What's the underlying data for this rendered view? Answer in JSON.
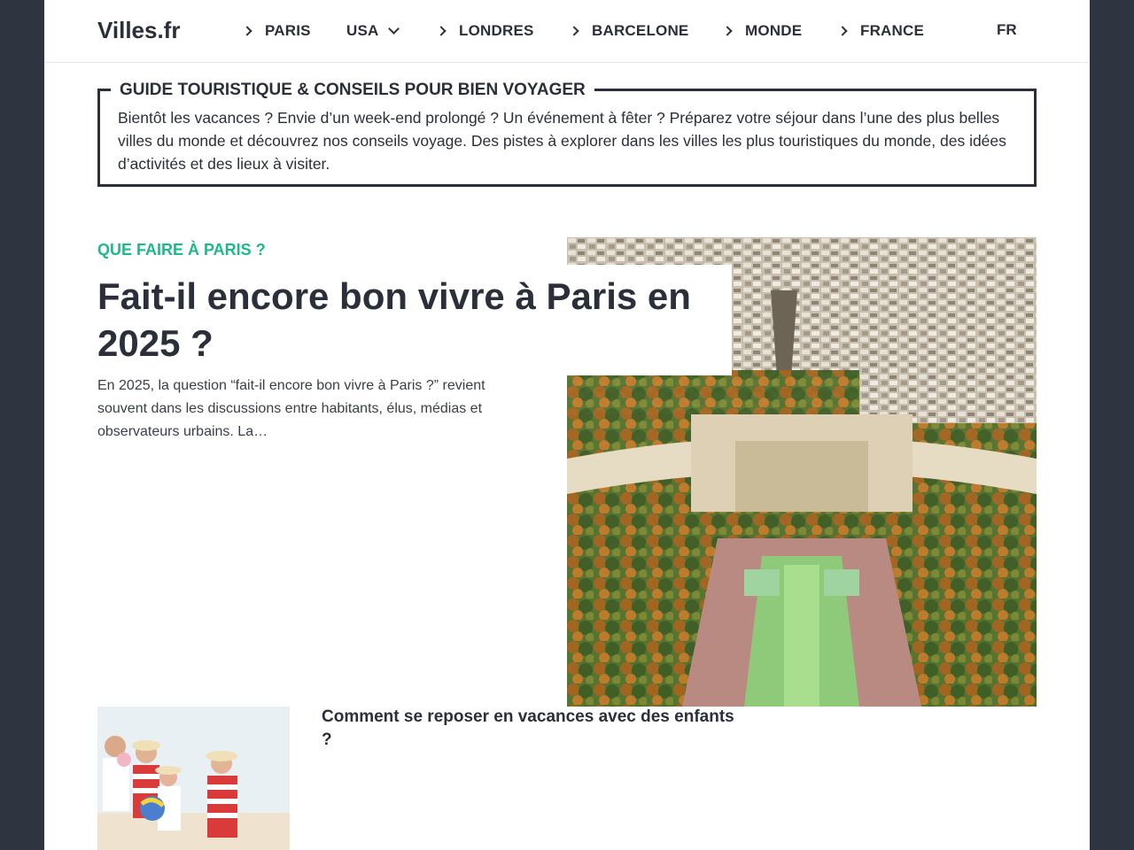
{
  "header": {
    "logo": "Villes.fr",
    "nav": [
      {
        "label": "PARIS"
      },
      {
        "label": "USA"
      },
      {
        "label": "LONDRES"
      },
      {
        "label": "BARCELONE"
      },
      {
        "label": "MONDE"
      },
      {
        "label": "FRANCE"
      }
    ],
    "lang": "FR"
  },
  "guide": {
    "title": "GUIDE TOURISTIQUE & CONSEILS POUR BIEN VOYAGER",
    "text": "Bientôt les vacances ? Envie d’un week-end prolongé ? Un événement à fêter ? Préparez votre séjour dans l’une des plus belles villes du monde et découvrez nos conseils voyage. Des pistes à explorer dans les villes les plus touristiques du monde, des idées d’activités et des lieux à visiter."
  },
  "featured": {
    "category": "QUE FAIRE À PARIS ?",
    "title": "Fait-il encore bon vivre à Paris en 2025 ?",
    "excerpt": "En 2025, la question “fait-il encore bon vivre à Paris ?” revient souvent dans les discussions entre habitants, élus, médias et observateurs urbains. La…",
    "image": "paris-trocadero-aerial-photo"
  },
  "second": {
    "title": "Comment se reposer en vacances avec des enfants ?",
    "image": "family-beach-photo"
  },
  "colors": {
    "background": "#2f3540",
    "text": "#2a2f3a",
    "accent": "#1db98a"
  }
}
